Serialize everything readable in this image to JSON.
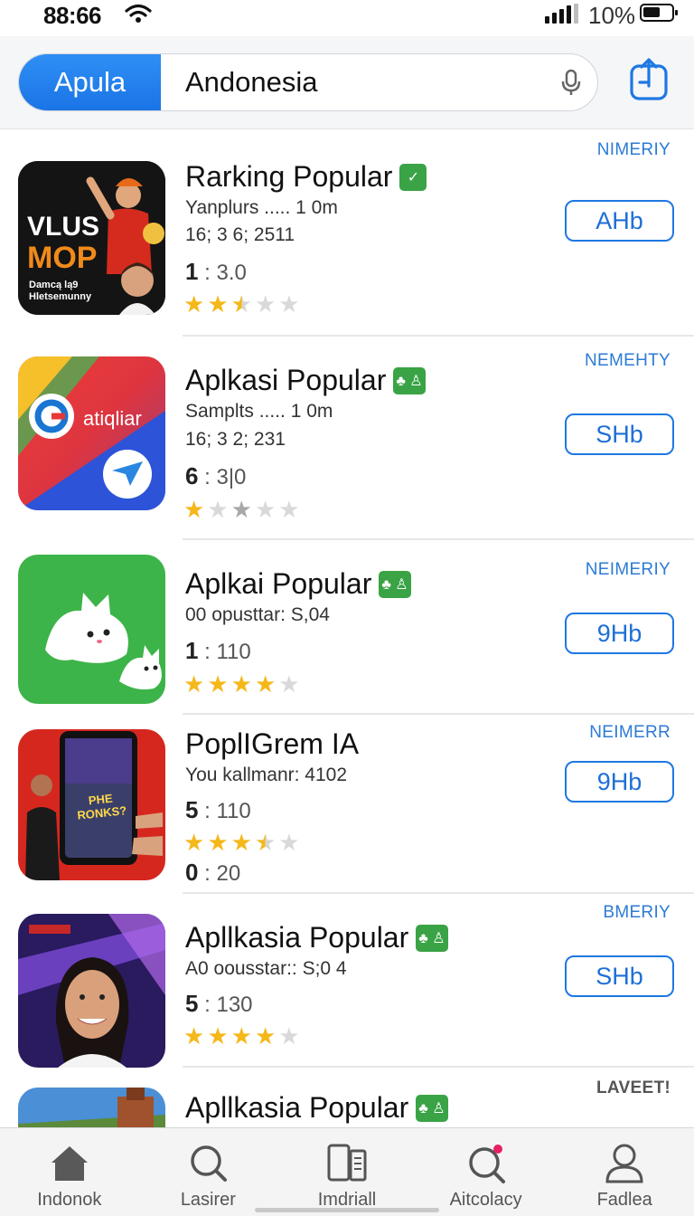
{
  "status_bar": {
    "time": "88:66",
    "battery_text": "10%"
  },
  "search": {
    "segment_label": "Apula",
    "query": "Andonesia"
  },
  "apps": [
    {
      "title": "Rarking Popular",
      "badge": "✓",
      "line1": "Yanplurs ..... 1 0m",
      "line2": "16; 3 6; 2511",
      "rating_big": "1",
      "rating_rest": " : 3.0",
      "stars": [
        "full",
        "full",
        "half",
        "empty",
        "empty"
      ],
      "tag": "NIMERIY",
      "button": "AHb",
      "icon_text_1": "VLUS",
      "icon_text_2": "MOP",
      "icon_text_3": "Damcą lą9",
      "icon_text_4": "Hletsemunny"
    },
    {
      "title": "Aplkasi Popular",
      "badge": "♣ ♙",
      "line1": "Samplts ..... 1 0m",
      "line2": "16; 3 2; 231",
      "rating_big": "6",
      "rating_rest": " : 3|0",
      "stars": [
        "full",
        "empty",
        "gray",
        "empty",
        "empty"
      ],
      "tag": "NEMEHTY",
      "button": "SHb",
      "icon_text_1": "atiqliar"
    },
    {
      "title": "Aplkai Popular",
      "badge": "♣ ♙",
      "line1": "00  opusttar: S,04",
      "rating_big": "1",
      "rating_rest": " : 110",
      "stars": [
        "full",
        "full",
        "full",
        "full",
        "empty"
      ],
      "tag": "NEIMERIY",
      "button": "9Hb"
    },
    {
      "title": "PoplIGrem IA",
      "line1": "You kallmanr: 4102",
      "rating_big": "5",
      "rating_rest": " : 110",
      "rating2_big": "0",
      "rating2_rest": " : 20",
      "stars": [
        "full",
        "full",
        "full",
        "half",
        "empty"
      ],
      "tag": "NEIMERR",
      "button": "9Hb",
      "icon_text_1": "PHE RONKS?"
    },
    {
      "title": "Apllkasia Popular",
      "badge": "♣ ♙",
      "line1": "A0  oousstar:: S;0 4",
      "rating_big": "5",
      "rating_rest": " : 130",
      "stars": [
        "full",
        "full",
        "full",
        "full",
        "empty"
      ],
      "tag": "BMERIY",
      "button": "SHb"
    },
    {
      "title": "Apllkasia Popular",
      "badge": "♣ ♙",
      "tag": "LAVEET!"
    }
  ],
  "tabs": [
    {
      "label": "Indonok",
      "icon": "home-icon"
    },
    {
      "label": "Lasirer",
      "icon": "search-icon"
    },
    {
      "label": "Imdriall",
      "icon": "apps-icon"
    },
    {
      "label": "Aitcolacy",
      "icon": "search-dot-icon"
    },
    {
      "label": "Fadlea",
      "icon": "person-icon"
    }
  ],
  "colors": {
    "accent": "#1e78e2",
    "star": "#f4b81a",
    "badge": "#3aa345"
  }
}
